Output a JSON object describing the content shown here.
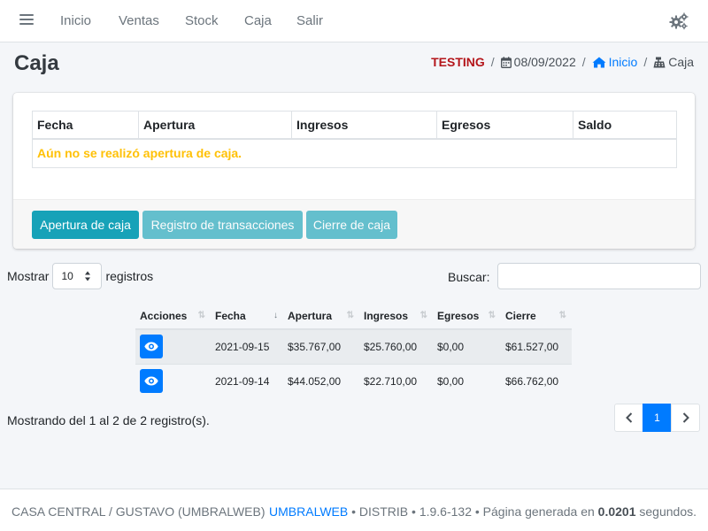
{
  "navbar": {
    "links": [
      "Inicio",
      "Ventas",
      "Stock",
      "Caja",
      "Salir"
    ],
    "menu_icon": "hamburger-icon",
    "settings_icon": "gears-icon"
  },
  "header": {
    "title": "Caja",
    "breadcrumb": {
      "environment": "TESTING",
      "date": "08/09/2022",
      "home": "Inicio",
      "current": "Caja"
    }
  },
  "cash_summary": {
    "columns": [
      "Fecha",
      "Apertura",
      "Ingresos",
      "Egresos",
      "Saldo"
    ],
    "empty_message": "Aún no se realizó apertura de caja.",
    "buttons": {
      "open": "Apertura de caja",
      "register": "Registro de transacciones",
      "close": "Cierre de caja"
    }
  },
  "datatable": {
    "length_prefix": "Mostrar",
    "length_value": "10",
    "length_suffix": "registros",
    "search_label": "Buscar:",
    "search_value": "",
    "columns": [
      "Acciones",
      "Fecha",
      "Apertura",
      "Ingresos",
      "Egresos",
      "Cierre"
    ],
    "rows": [
      {
        "fecha": "2021-09-15",
        "apertura": "$35.767,00",
        "ingresos": "$25.760,00",
        "egresos": "$0,00",
        "cierre": "$61.527,00"
      },
      {
        "fecha": "2021-09-14",
        "apertura": "$44.052,00",
        "ingresos": "$22.710,00",
        "egresos": "$0,00",
        "cierre": "$66.762,00"
      }
    ],
    "info": "Mostrando del 1 al 2 de 2 registro(s).",
    "pagination": {
      "prev": "‹",
      "current": "1",
      "next": "›"
    }
  },
  "footer": {
    "left": "CASA CENTRAL / GUSTAVO (UMBRALWEB)",
    "brand": "UMBRALWEB",
    "details": " • DISTRIB • 1.9.6-132 • Página generada en ",
    "time": "0.0201",
    "time_suffix": " segundos."
  },
  "colors": {
    "primary": "#007bff",
    "info": "#17a2b8",
    "warning": "#ffc107",
    "danger_text": "#b4161b"
  }
}
